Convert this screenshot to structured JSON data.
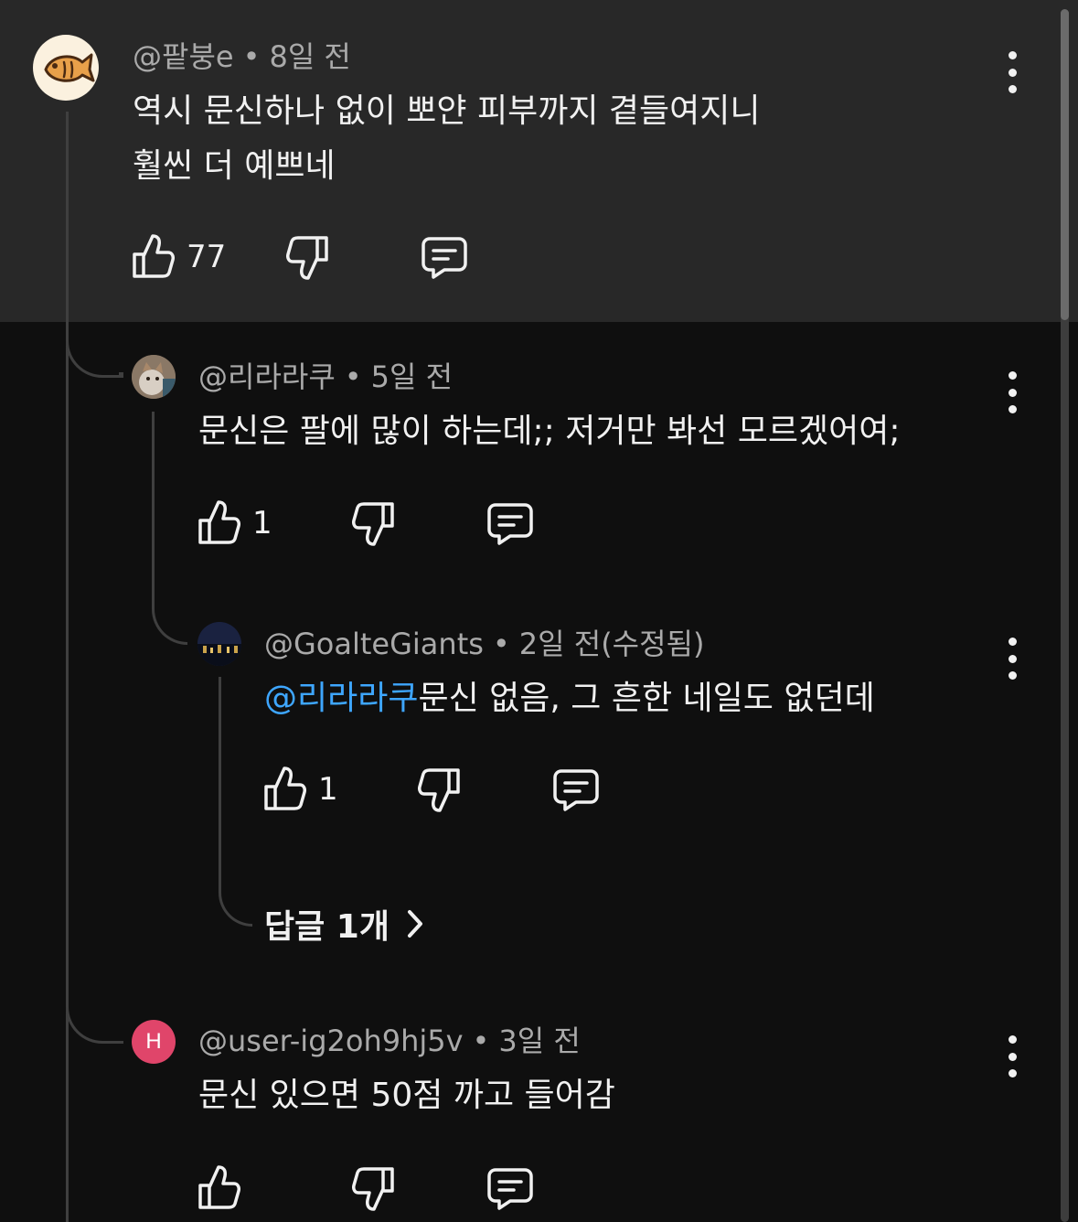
{
  "comments": [
    {
      "author": "@팥붕e",
      "time": "8일 전",
      "text_line1": "역시 문신하나 없이 뽀얀 피부까지 곁들여지니",
      "text_line2": "훨씬 더 예쁘네",
      "likes": "77",
      "avatar_icon": "taiyaki-fish-icon",
      "highlighted": true
    },
    {
      "author": "@리라라쿠",
      "time": "5일 전",
      "text": "문신은 팔에 많이 하는데;; 저거만 봐선 모르겠어여;",
      "likes": "1",
      "avatar_icon": "cat-photo-avatar"
    },
    {
      "author": "@GoalteGiants",
      "time": "2일 전(수정됨)",
      "mention": "@리라라쿠",
      "text": "문신 없음, 그 흔한 네일도 없던데",
      "likes": "1",
      "avatar_icon": "night-city-photo-avatar",
      "replies_label": "답글 1개"
    },
    {
      "author": "@user-ig2oh9hj5v",
      "time": "3일 전",
      "text": "문신 있으면 50점 까고 들어감",
      "likes": "",
      "avatar_letter": "H",
      "avatar_color": "#e0456a"
    }
  ],
  "colors": {
    "background": "#0f0f0f",
    "highlight": "#282828",
    "mention": "#3ea6ff",
    "meta_text": "#aaaaaa"
  }
}
